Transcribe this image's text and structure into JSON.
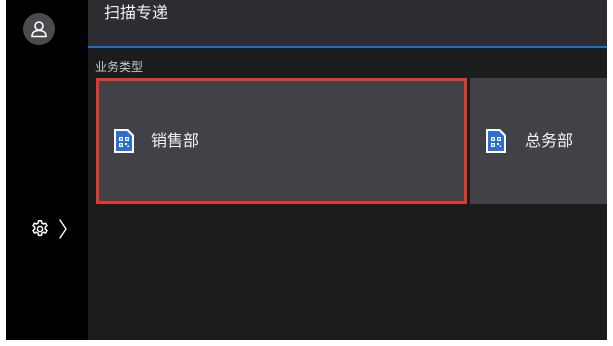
{
  "header": {
    "title": "扫描专递"
  },
  "section": {
    "label": "业务类型"
  },
  "cards": [
    {
      "label": "销售部",
      "icon": "qr-document-icon",
      "selected": true
    },
    {
      "label": "总务部",
      "icon": "qr-document-icon",
      "selected": false
    }
  ],
  "sidebar": {
    "avatar_icon": "user-icon",
    "settings_icon": "gear-icon",
    "expand_icon": "chevron-right-icon"
  },
  "colors": {
    "accent_blue": "#1f6fd1",
    "selection_red": "#e03a2d",
    "card_bg": "#404247",
    "header_bg": "#2c2d31"
  }
}
